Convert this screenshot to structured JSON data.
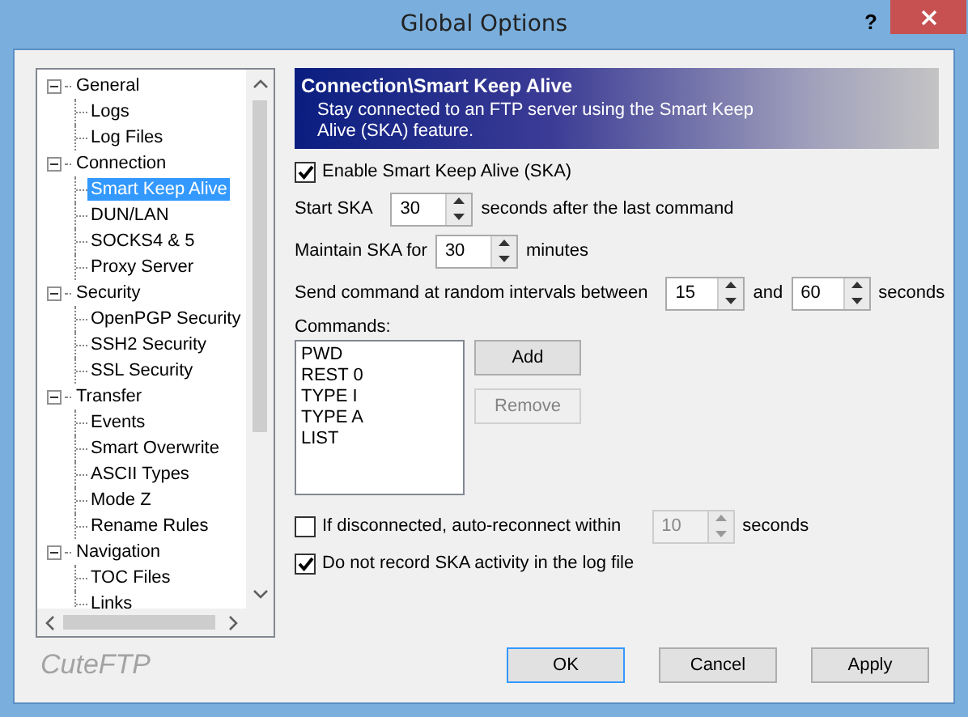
{
  "window": {
    "title": "Global Options",
    "help": "?"
  },
  "tree": [
    {
      "label": "General",
      "expanded": true,
      "selected": false,
      "children": [
        {
          "label": "Logs",
          "selected": false
        },
        {
          "label": "Log Files",
          "selected": false
        }
      ]
    },
    {
      "label": "Connection",
      "expanded": true,
      "selected": false,
      "children": [
        {
          "label": "Smart Keep Alive",
          "selected": true
        },
        {
          "label": "DUN/LAN",
          "selected": false
        },
        {
          "label": "SOCKS4 & 5",
          "selected": false
        },
        {
          "label": "Proxy Server",
          "selected": false
        }
      ]
    },
    {
      "label": "Security",
      "expanded": true,
      "selected": false,
      "children": [
        {
          "label": "OpenPGP Security",
          "selected": false
        },
        {
          "label": "SSH2 Security",
          "selected": false
        },
        {
          "label": "SSL Security",
          "selected": false
        }
      ]
    },
    {
      "label": "Transfer",
      "expanded": true,
      "selected": false,
      "children": [
        {
          "label": "Events",
          "selected": false
        },
        {
          "label": "Smart Overwrite",
          "selected": false
        },
        {
          "label": "ASCII Types",
          "selected": false
        },
        {
          "label": "Mode Z",
          "selected": false
        },
        {
          "label": "Rename Rules",
          "selected": false
        }
      ]
    },
    {
      "label": "Navigation",
      "expanded": true,
      "selected": false,
      "children": [
        {
          "label": "TOC Files",
          "selected": false
        },
        {
          "label": "Links",
          "selected": false
        }
      ]
    }
  ],
  "panel": {
    "title": "Connection\\Smart Keep Alive",
    "description": "Stay connected to an FTP server using the Smart Keep Alive (SKA) feature."
  },
  "enable_ska": {
    "label": "Enable Smart Keep Alive (SKA)",
    "checked": true
  },
  "start_ska": {
    "label": "Start SKA",
    "value": "30",
    "suffix": "seconds after the last command"
  },
  "maintain_ska": {
    "label": "Maintain SKA for",
    "value": "30",
    "suffix": "minutes"
  },
  "random_interval": {
    "label": "Send command at random intervals between",
    "from": "15",
    "joiner": "and",
    "to": "60",
    "suffix": "seconds"
  },
  "commands": {
    "label": "Commands:",
    "items": [
      "PWD",
      "REST 0",
      "TYPE I",
      "TYPE A",
      "LIST"
    ],
    "buttons": [
      {
        "label": "Add",
        "disabled": false
      },
      {
        "label": "Remove",
        "disabled": true
      }
    ]
  },
  "auto_reconnect": {
    "label": "If disconnected, auto-reconnect within",
    "checked": false,
    "value": "10",
    "suffix": "seconds"
  },
  "no_log": {
    "label": "Do not record SKA activity in the log file",
    "checked": true
  },
  "brand": "CuteFTP",
  "buttons": [
    {
      "label": "OK",
      "default": true
    },
    {
      "label": "Cancel",
      "default": false
    },
    {
      "label": "Apply",
      "default": false
    }
  ]
}
